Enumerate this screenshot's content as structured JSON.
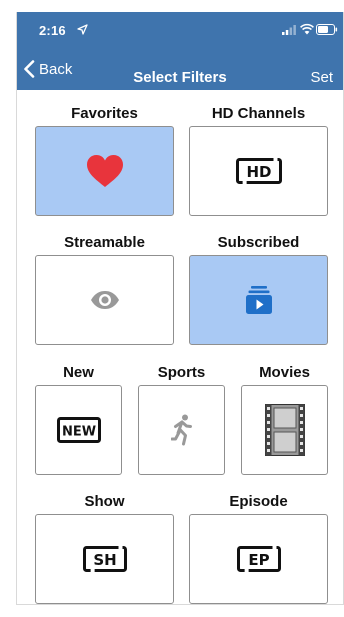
{
  "status_bar": {
    "time": "2:16",
    "icons": [
      "location-arrow-icon",
      "signal-icon",
      "wifi-icon",
      "battery-icon"
    ]
  },
  "nav": {
    "back_label": "Back",
    "title": "Select Filters",
    "set_label": "Set"
  },
  "colors": {
    "nav_background": "#3f74ad",
    "selected_tile": "#a9c9f4",
    "heart": "#e8343c",
    "stack_icon": "#1f6fc8",
    "disabled_icon": "#999999"
  },
  "filters": [
    {
      "label": "Favorites",
      "icon": "heart-icon",
      "selected": true
    },
    {
      "label": "HD Channels",
      "icon": "hd-badge-icon",
      "badge_text": "HD",
      "selected": false
    },
    {
      "label": "Streamable",
      "icon": "eye-icon",
      "selected": false
    },
    {
      "label": "Subscribed",
      "icon": "stacked-play-icon",
      "selected": true
    },
    {
      "label": "New",
      "icon": "new-badge-icon",
      "badge_text": "NEW",
      "selected": false
    },
    {
      "label": "Sports",
      "icon": "running-figure-icon",
      "selected": false
    },
    {
      "label": "Movies",
      "icon": "film-strip-icon",
      "selected": false
    },
    {
      "label": "Show",
      "icon": "sh-badge-icon",
      "badge_text": "SH",
      "selected": false
    },
    {
      "label": "Episode",
      "icon": "ep-badge-icon",
      "badge_text": "EP",
      "selected": false
    }
  ]
}
